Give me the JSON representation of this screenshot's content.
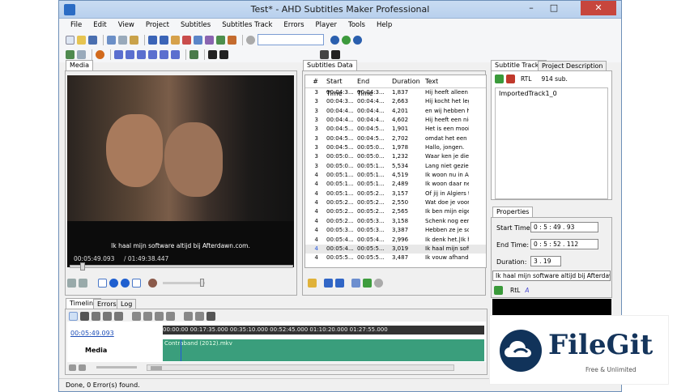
{
  "window": {
    "title": "Test* - AHD Subtitles Maker Professional",
    "minimize": "–",
    "maximize": "□",
    "close": "✕"
  },
  "menu": [
    "File",
    "Edit",
    "View",
    "Project",
    "Subtitles",
    "Subtitles Track",
    "Errors",
    "Player",
    "Tools",
    "Help"
  ],
  "media": {
    "tab": "Media",
    "subtitle": "Ik haal mijn software altijd bij Afterdawn.com.",
    "current_time": "00:05:49.093",
    "total_time": "/  01:49:38.447"
  },
  "subtitles": {
    "tab": "Subtitles Data",
    "columns": [
      "#",
      "Start Time",
      "End Time",
      "Duration",
      "Text"
    ],
    "rows": [
      [
        "3",
        "00:04:3...",
        "00:04:3...",
        "1,837",
        "Hij heeft alleen he"
      ],
      [
        "3",
        "00:04:3...",
        "00:04:4...",
        "2,663",
        "Hij kocht het lege"
      ],
      [
        "3",
        "00:04:4...",
        "00:04:4...",
        "4,201",
        "en wij hebben he"
      ],
      [
        "3",
        "00:04:4...",
        "00:04:4...",
        "4,602",
        "Hij heeft een nieu"
      ],
      [
        "3",
        "00:04:5...",
        "00:04:5...",
        "1,901",
        "Het is een mooie"
      ],
      [
        "3",
        "00:04:5...",
        "00:04:5...",
        "2,702",
        "omdat het een mo"
      ],
      [
        "3",
        "00:04:5...",
        "00:05:0...",
        "1,978",
        "Hallo, jongen."
      ],
      [
        "3",
        "00:05:0...",
        "00:05:0...",
        "1,232",
        "Waar ken je die e"
      ],
      [
        "3",
        "00:05:0...",
        "00:05:1...",
        "5,534",
        "Lang niet gezien."
      ],
      [
        "4",
        "00:05:1...",
        "00:05:1...",
        "4,519",
        "Ik woon nu in Alg"
      ],
      [
        "4",
        "00:05:1...",
        "00:05:1...",
        "2,489",
        "Ik woon daar net"
      ],
      [
        "4",
        "00:05:1...",
        "00:05:2...",
        "3,157",
        "Of jij in Algiers thu"
      ],
      [
        "4",
        "00:05:2...",
        "00:05:2...",
        "2,550",
        "Wat doe je voor v"
      ],
      [
        "4",
        "00:05:2...",
        "00:05:2...",
        "2,565",
        "Ik ben mijn eigen"
      ],
      [
        "4",
        "00:05:2...",
        "00:05:3...",
        "3,158",
        "Schenk nog eens"
      ],
      [
        "4",
        "00:05:3...",
        "00:05:3...",
        "3,387",
        "Hebben ze je sch"
      ],
      [
        "4",
        "00:05:4...",
        "00:05:4...",
        "2,996",
        "Ik denk het.|Ik he"
      ],
      [
        "4",
        "00:05:4...",
        "00:05:5...",
        "3,019",
        "Ik haal mijn softw"
      ],
      [
        "4",
        "00:05:5...",
        "00:05:5...",
        "3,487",
        "Ik vouw afhandele"
      ]
    ],
    "selected_index": 17
  },
  "tracks": {
    "tabs": [
      "Subtitle Tracks",
      "Project Description"
    ],
    "rtl": "RTL",
    "count": "914 sub.",
    "items": [
      "ImportedTrack1_0"
    ]
  },
  "properties": {
    "tab": "Properties",
    "start_label": "Start Time:",
    "start_value": "0 : 5 : 49 . 93",
    "end_label": "End Time:",
    "end_value": "0 : 5 : 52 . 112",
    "duration_label": "Duration:",
    "duration_value": "3 . 19",
    "text_value": "Ik haal mijn software altijd bij Afterdawn.",
    "rtl": "RtL"
  },
  "timeline": {
    "tabs": [
      "Timeline",
      "Errors",
      "Log"
    ],
    "current": "00:05:49.093",
    "track_label": "Media",
    "clip": "Contraband (2012).mkv",
    "ruler": "00:00:00    00:17:35.000    00:35:10.000    00:52:45.000    01:10:20.000    01:27:55.000"
  },
  "status": "Done, 0 Error(s) found.",
  "watermark": {
    "name": "FileGit",
    "tagline": "Free & Unlimited"
  }
}
